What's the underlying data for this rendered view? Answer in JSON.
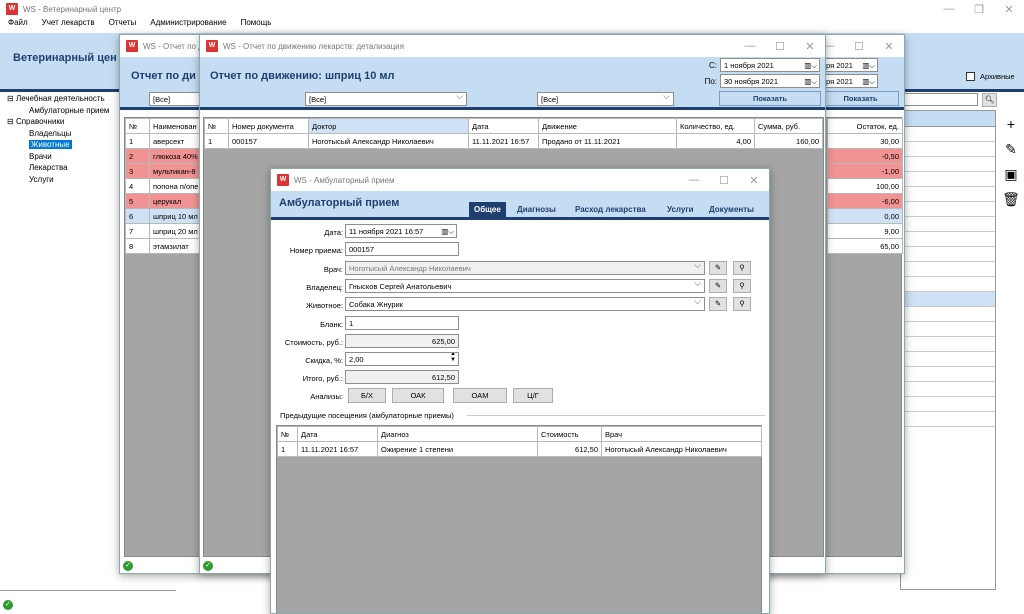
{
  "app": {
    "title": "WS - Ветеринарный центр",
    "menu": [
      "Файл",
      "Учет лекарств",
      "Отчеты",
      "Администрирование",
      "Помощь"
    ],
    "header": "Ветеринарный цен",
    "archive_label": "Архивные"
  },
  "tree": {
    "root1": "Лечебная деятельность",
    "root1_child": "Амбулаторные прием",
    "root2": "Справочники",
    "items": [
      "Владельцы",
      "Животные",
      "Врачи",
      "Лекарства",
      "Услуги"
    ]
  },
  "side_toolbar": [
    "plus-icon",
    "pencil-icon",
    "archive-icon",
    "trash-icon"
  ],
  "report1": {
    "title": "WS - Отчет по движению лекарств",
    "heading": "Отчет по ди",
    "filter": "[Все]",
    "date_from_label": "С:",
    "date_to_label": "По:",
    "date_from_tail": "ря 2021",
    "date_to_tail": "ря 2021",
    "show_button": "Показать",
    "columns": [
      "№",
      "Наименован"
    ],
    "rows": [
      [
        "1",
        "аверсект"
      ],
      [
        "2",
        "глюкоза 40%"
      ],
      [
        "3",
        "мультикан-8"
      ],
      [
        "4",
        "попона п/опе"
      ],
      [
        "5",
        "церукал"
      ],
      [
        "6",
        "шприц 10 мл"
      ],
      [
        "7",
        "шприц 20 мл"
      ],
      [
        "8",
        "этамзилат"
      ]
    ],
    "stock_header": "Остаток, ед.",
    "stock": [
      "30,00",
      "-0,50",
      "-1,00",
      "100,00",
      "-6,00",
      "0,00",
      "9,00",
      "65,00"
    ]
  },
  "report2": {
    "title": "WS - Отчет по движению лекарств: детализация",
    "heading": "Отчет по движению: шприц 10 мл",
    "filter1": "[Все]",
    "filter2": "[Все]",
    "date_from_label": "С:",
    "date_from": "1  ноября  2021",
    "date_to_label": "По:",
    "date_to": "30  ноября  2021",
    "show_button": "Показать",
    "columns": [
      "№",
      "Номер документа",
      "Доктор",
      "Дата",
      "Движение",
      "Количество, ед.",
      "Сумма, руб."
    ],
    "rows": [
      [
        "1",
        "000157",
        "Ноготысый Александр Николаевич",
        "11.11.2021 16:57",
        "Продано от 11.11.2021",
        "4,00",
        "160,00"
      ]
    ]
  },
  "visit": {
    "title": "WS - Амбулаторный прием",
    "heading": "Амбулаторный прием",
    "tabs": [
      "Общее",
      "Диагнозы",
      "Расход лекарства",
      "Услуги",
      "Документы"
    ],
    "fields": {
      "date_label": "Дата:",
      "date": "11  ноября  2021 16:57",
      "number_label": "Номер приема:",
      "number": "000157",
      "doctor_label": "Врач:",
      "doctor": "Ноготысый Александр Николаевич",
      "owner_label": "Владелец:",
      "owner": "Гнысков Сергей Анатольевич",
      "animal_label": "Животное:",
      "animal": "Собака Жнурик",
      "form_label": "Бланк:",
      "form": "1",
      "cost_label": "Стоимость, руб.:",
      "cost": "625,00",
      "discount_label": "Скидка, %:",
      "discount": "2,00",
      "total_label": "Итого, руб.:",
      "total": "612,50",
      "analyses_label": "Анализы:"
    },
    "analyses": [
      "Б/Х",
      "ОАК",
      "ОАМ",
      "Ц/Г"
    ],
    "prev_title": "Предыдущие посещения (амбулаторные приемы)",
    "prev_columns": [
      "№",
      "Дата",
      "Диагноз",
      "Стоимость",
      "Врач"
    ],
    "prev_rows": [
      [
        "1",
        "11.11.2021 16:57",
        "Ожирение 1 степени",
        "612,50",
        "Ноготысый Александр Николаевич"
      ]
    ]
  }
}
